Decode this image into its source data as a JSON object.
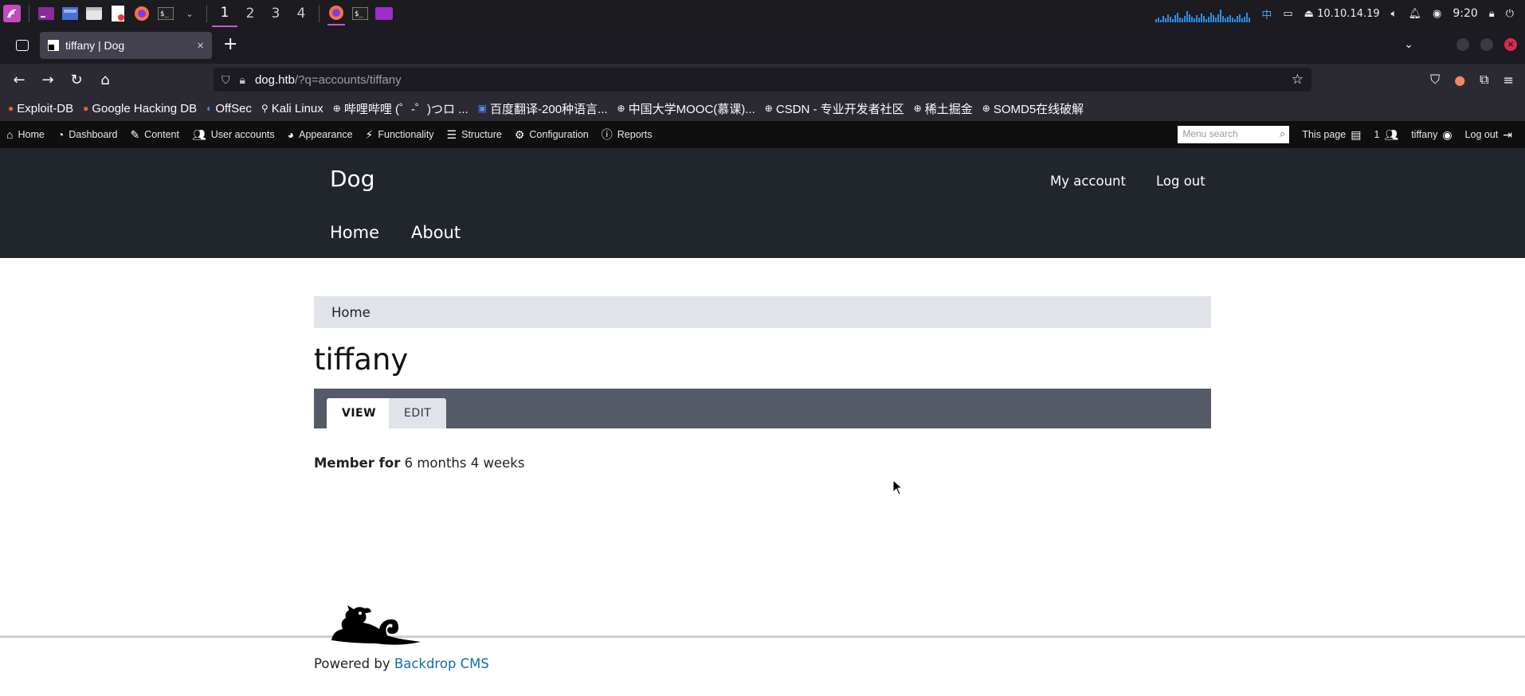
{
  "taskbar": {
    "workspaces": [
      "1",
      "2",
      "3",
      "4"
    ],
    "ip": "10.10.14.19",
    "ime": "中",
    "clock": "9:20"
  },
  "browser": {
    "tab_title": "tiffany | Dog",
    "tab_close": "×",
    "new_tab": "+",
    "url_host": "dog.htb",
    "url_path": "/?q=accounts/tiffany",
    "bookmarks": [
      "Exploit-DB",
      "Google Hacking DB",
      "OffSec",
      "Kali Linux",
      "哔哩哔哩 (゜-゜)つロ ...",
      "百度翻译-200种语言...",
      "中国大学MOOC(慕课)...",
      "CSDN - 专业开发者社区",
      "稀土掘金",
      "SOMD5在线破解"
    ]
  },
  "admin_bar": {
    "items": [
      "Home",
      "Dashboard",
      "Content",
      "User accounts",
      "Appearance",
      "Functionality",
      "Structure",
      "Configuration",
      "Reports"
    ],
    "search_placeholder": "Menu search",
    "this_page": "This page",
    "user_count": "1",
    "username": "tiffany",
    "logout": "Log out"
  },
  "site": {
    "name": "Dog",
    "user_menu": [
      "My account",
      "Log out"
    ],
    "main_menu": [
      "Home",
      "About"
    ]
  },
  "content": {
    "breadcrumb": "Home",
    "title": "tiffany",
    "tabs": [
      "VIEW",
      "EDIT"
    ],
    "member_label": "Member for",
    "member_value": "6 months 4 weeks"
  },
  "footer": {
    "powered_by": "Powered by",
    "link": "Backdrop CMS"
  }
}
